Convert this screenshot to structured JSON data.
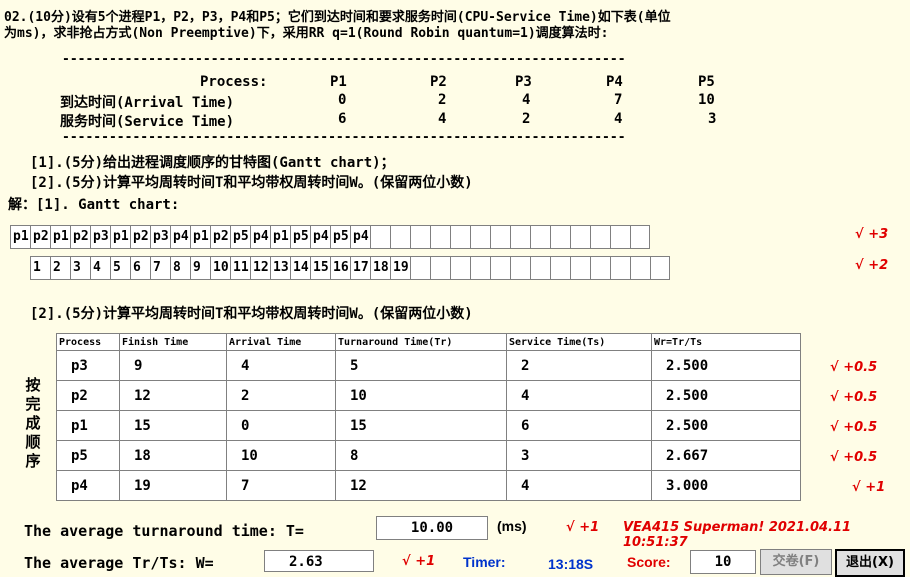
{
  "question": {
    "line1": "02.(10分)设有5个进程P1，P2，P3，P4和P5；它们到达时间和要求服务时间(CPU-Service Time)如下表(单位",
    "line2": "为ms)，求非抢占方式(Non Preemptive)下，采用RR q=1(Round Robin quantum=1)调度算法时:"
  },
  "process_table": {
    "header_label": "Process:",
    "processes": [
      "P1",
      "P2",
      "P3",
      "P4",
      "P5"
    ],
    "arrival_label": "到达时间(Arrival Time)",
    "arrival": [
      "0",
      "2",
      "4",
      "7",
      "10"
    ],
    "service_label": "服务时间(Service Time)",
    "service": [
      "6",
      "4",
      "2",
      "4",
      "3"
    ]
  },
  "tasks": {
    "t1": "[1].(5分)给出进程调度顺序的甘特图(Gantt chart)；",
    "t2": "[2].(5分)计算平均周转时间T和平均带权周转时间W。(保留两位小数)",
    "answer_label": "解：[1]. Gantt chart:"
  },
  "gantt": {
    "sequence": [
      "p1",
      "p2",
      "p1",
      "p2",
      "p3",
      "p1",
      "p2",
      "p3",
      "p4",
      "p1",
      "p2",
      "p5",
      "p4",
      "p1",
      "p5",
      "p4",
      "p5",
      "p4",
      "",
      "",
      "",
      "",
      "",
      "",
      "",
      "",
      "",
      "",
      "",
      "",
      "",
      ""
    ],
    "times": [
      "1",
      "2",
      "3",
      "4",
      "5",
      "6",
      "7",
      "8",
      "9",
      "10",
      "11",
      "12",
      "13",
      "14",
      "15",
      "16",
      "17",
      "18",
      "19",
      "",
      "",
      "",
      "",
      "",
      "",
      "",
      "",
      "",
      "",
      "",
      "",
      ""
    ],
    "mark_seq": "√ +3",
    "mark_time": "√ +2"
  },
  "part2": {
    "title": "[2].(5分)计算平均周转时间T和平均带权周转时间W。(保留两位小数)",
    "side_label": [
      "按",
      "完",
      "成",
      "顺",
      "序"
    ],
    "headers": [
      "Process",
      "Finish Time",
      "Arrival Time",
      "Turnaround Time(Tr)",
      "Service Time(Ts)",
      "Wr=Tr/Ts"
    ],
    "rows": [
      {
        "process": "p3",
        "finish": "9",
        "arrival": "4",
        "turnaround": "5",
        "service": "2",
        "weighted": "2.500",
        "mark": "√ +0.5"
      },
      {
        "process": "p2",
        "finish": "12",
        "arrival": "2",
        "turnaround": "10",
        "service": "4",
        "weighted": "2.500",
        "mark": "√ +0.5"
      },
      {
        "process": "p1",
        "finish": "15",
        "arrival": "0",
        "turnaround": "15",
        "service": "6",
        "weighted": "2.500",
        "mark": "√ +0.5"
      },
      {
        "process": "p5",
        "finish": "18",
        "arrival": "10",
        "turnaround": "8",
        "service": "3",
        "weighted": "2.667",
        "mark": "√ +0.5"
      },
      {
        "process": "p4",
        "finish": "19",
        "arrival": "7",
        "turnaround": "12",
        "service": "4",
        "weighted": "3.000",
        "mark": "√ +1"
      }
    ]
  },
  "footer": {
    "avg_turnaround_label": "The average turnaround time: T=",
    "avg_turnaround_value": "10.00",
    "unit": "(ms)",
    "mark_turnaround": "√ +1",
    "signature": "VEA415 Superman! 2021.04.11 10:51:37",
    "avg_weighted_label": "The average Tr/Ts: W=",
    "avg_weighted_value": "2.63",
    "mark_weighted": "√ +1",
    "timer_label": "Timer:",
    "timer_value": "13:18S",
    "score_label": "Score:",
    "score_value": "10",
    "submit_button": "交卷(F)",
    "exit_button": "退出(X)"
  }
}
